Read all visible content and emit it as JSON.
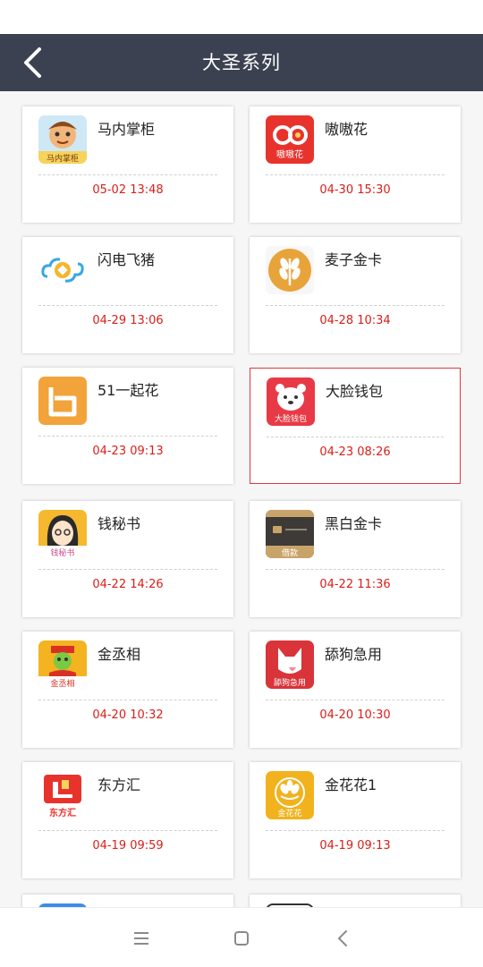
{
  "header": {
    "title": "大圣系列"
  },
  "colors": {
    "header_bg": "#3b4150",
    "time_red": "#d91e18",
    "selected_border": "#e0383e"
  },
  "apps": [
    {
      "name": "马内掌柜",
      "time": "05-02 13:48",
      "icon": "majordomo-mascot-icon",
      "icon_text": "马内掌柜"
    },
    {
      "name": "嗷嗷花",
      "time": "04-30 15:30",
      "icon": "ao-ao-hua-icon",
      "icon_text": "嗷嗷花"
    },
    {
      "name": "闪电飞猪",
      "time": "04-29 13:06",
      "icon": "cloud-coin-icon",
      "icon_text": ""
    },
    {
      "name": "麦子金卡",
      "time": "04-28 10:34",
      "icon": "wheat-icon",
      "icon_text": ""
    },
    {
      "name": "51一起花",
      "time": "04-23 09:13",
      "icon": "orange-b-icon",
      "icon_text": ""
    },
    {
      "name": "大脸钱包",
      "time": "04-23 08:26",
      "icon": "bear-face-icon",
      "icon_text": "大脸钱包"
    },
    {
      "name": "钱秘书",
      "time": "04-22 14:26",
      "icon": "secretary-girl-icon",
      "icon_text": "钱秘书"
    },
    {
      "name": "黑白金卡",
      "time": "04-22 11:36",
      "icon": "black-card-icon",
      "icon_text": "借款"
    },
    {
      "name": "金丞相",
      "time": "04-20 10:32",
      "icon": "chancellor-icon",
      "icon_text": "金丞相"
    },
    {
      "name": "舔狗急用",
      "time": "04-20 10:30",
      "icon": "dog-head-icon",
      "icon_text": "舔狗急用"
    },
    {
      "name": "东方汇",
      "time": "04-19 09:59",
      "icon": "dongfanghui-logo-icon",
      "icon_text": "东方汇"
    },
    {
      "name": "金花花1",
      "time": "04-19 09:13",
      "icon": "gold-flower-icon",
      "icon_text": "金花花"
    },
    {
      "name": "",
      "time": "",
      "icon": "blue-app-icon",
      "icon_text": ""
    },
    {
      "name": "",
      "time": "",
      "icon": "outline-app-icon",
      "icon_text": ""
    }
  ],
  "selected_index": 5
}
